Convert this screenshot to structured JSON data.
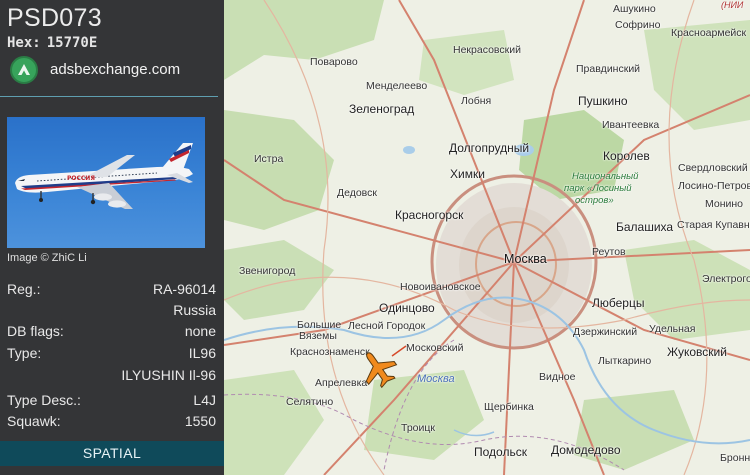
{
  "aircraft": {
    "callsign": "PSD073",
    "hex_label": "Hex:",
    "hex_value": "15770E",
    "source": "adsbexchange.com",
    "photo_credit": "Image © ZhiC Li",
    "airline_livery_text": "РОССИЯ"
  },
  "details": [
    {
      "key": "Reg.:",
      "value": "RA-96014"
    },
    {
      "key": "",
      "value": "Russia"
    },
    {
      "key": "DB flags:",
      "value": "none"
    },
    {
      "key": "Type:",
      "value": "IL96"
    },
    {
      "key": "",
      "value": "ILYUSHIN Il-96"
    },
    {
      "key": "Type Desc.:",
      "value": "L4J"
    },
    {
      "key": "Squawk:",
      "value": "1550"
    }
  ],
  "spatial_button": "SPATIAL",
  "colors": {
    "sidebar_bg": "#343537",
    "accent_teal": "#0f4a5a",
    "aircraft_orange": "#f08a1e",
    "logo_green": "#37a35b"
  },
  "icons": {
    "source_logo": "adsbexchange-logo-icon",
    "aircraft_marker": "airplane-icon"
  },
  "map": {
    "labels": [
      {
        "id": "ashukino",
        "text": "Ашукино"
      },
      {
        "id": "nii",
        "text": "(НИИ"
      },
      {
        "id": "sofrino",
        "text": "Софрино"
      },
      {
        "id": "krasnoarmeysk",
        "text": "Красноармейск"
      },
      {
        "id": "nekrasovsky",
        "text": "Некрасовский"
      },
      {
        "id": "povarovo",
        "text": "Поварово"
      },
      {
        "id": "mendeleevo",
        "text": "Менделеево"
      },
      {
        "id": "pravdinsky",
        "text": "Правдинский"
      },
      {
        "id": "zelenograd",
        "text": "Зеленоград"
      },
      {
        "id": "lobnya",
        "text": "Лобня"
      },
      {
        "id": "pushkino",
        "text": "Пушкино"
      },
      {
        "id": "ivanteevka",
        "text": "Ивантеевка"
      },
      {
        "id": "dolgoprudny",
        "text": "Долгопрудный"
      },
      {
        "id": "korolev",
        "text": "Королев"
      },
      {
        "id": "istra",
        "text": "Истра"
      },
      {
        "id": "khimki",
        "text": "Химки"
      },
      {
        "id": "park1",
        "text": "Национальный"
      },
      {
        "id": "park2",
        "text": "парк «Лосиный"
      },
      {
        "id": "park3",
        "text": "остров»"
      },
      {
        "id": "sverdlovsky",
        "text": "Свердловский"
      },
      {
        "id": "losino",
        "text": "Лосино-Петровский"
      },
      {
        "id": "dedovsk",
        "text": "Дедовск"
      },
      {
        "id": "monino",
        "text": "Монино"
      },
      {
        "id": "krasnogorsk",
        "text": "Красногорск"
      },
      {
        "id": "balashikha",
        "text": "Балашиха"
      },
      {
        "id": "staraya",
        "text": "Старая Купавна"
      },
      {
        "id": "moskva",
        "text": "Москва"
      },
      {
        "id": "reutov",
        "text": "Реутов"
      },
      {
        "id": "zvenigorod",
        "text": "Звенигород"
      },
      {
        "id": "elektrogorsk",
        "text": "Электрогорск"
      },
      {
        "id": "novoivankovskoe",
        "text": "Новоивановское"
      },
      {
        "id": "lyubertsy",
        "text": "Люберцы"
      },
      {
        "id": "odintsovo",
        "text": "Одинцово"
      },
      {
        "id": "bolshie1",
        "text": "Большие"
      },
      {
        "id": "bolshie2",
        "text": "Вяземы"
      },
      {
        "id": "lesnoy",
        "text": "Лесной Городок"
      },
      {
        "id": "dzerzhinsky",
        "text": "Дзержинский"
      },
      {
        "id": "udelnaya",
        "text": "Удельная"
      },
      {
        "id": "krasnoznamensk",
        "text": "Краснознаменск"
      },
      {
        "id": "moskovsky",
        "text": "Московский"
      },
      {
        "id": "zhukovsky",
        "text": "Жуковский"
      },
      {
        "id": "lytkarino",
        "text": "Лыткарино"
      },
      {
        "id": "aprelevka",
        "text": "Апрелевка"
      },
      {
        "id": "moskva_river",
        "text": "Москва"
      },
      {
        "id": "vidnoe",
        "text": "Видное"
      },
      {
        "id": "selyatino",
        "text": "Селятино"
      },
      {
        "id": "shcherbinka",
        "text": "Щербинка"
      },
      {
        "id": "troitsk",
        "text": "Троицк"
      },
      {
        "id": "podolsk",
        "text": "Подольск"
      },
      {
        "id": "domodedovo",
        "text": "Домодедово"
      },
      {
        "id": "bronnitsy",
        "text": "Бронн"
      }
    ]
  }
}
